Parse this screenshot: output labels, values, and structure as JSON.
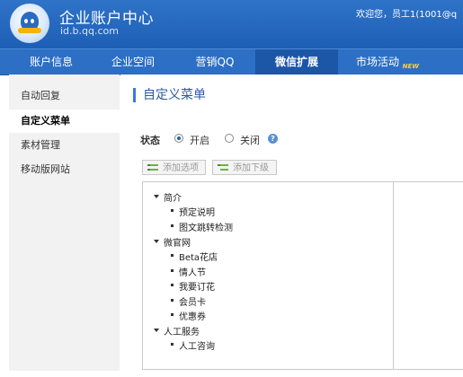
{
  "header": {
    "title": "企业账户中心",
    "subtitle": "id.b.qq.com",
    "welcome": "欢迎您，员工1(1001@q"
  },
  "nav": {
    "items": [
      {
        "label": "账户信息"
      },
      {
        "label": "企业空间"
      },
      {
        "label": "营销QQ"
      },
      {
        "label": "微信扩展"
      },
      {
        "label": "市场活动"
      }
    ],
    "new_badge": "NEW",
    "active": "微信扩展"
  },
  "sidebar": {
    "items": [
      {
        "label": "自动回复"
      },
      {
        "label": "自定义菜单"
      },
      {
        "label": "素材管理"
      },
      {
        "label": "移动版网站"
      }
    ],
    "active": "自定义菜单"
  },
  "main": {
    "title": "自定义菜单",
    "status_label": "状态",
    "status_on": "开启",
    "status_off": "关闭",
    "status_selected": "开启",
    "help": "?",
    "add_item_button": "添加选项",
    "add_sub_button": "添加下级"
  },
  "tree": {
    "groups": [
      {
        "label": "简介",
        "children": [
          "预定说明",
          "图文跳转检测"
        ]
      },
      {
        "label": "微官网",
        "children": [
          "Beta花店",
          "情人节",
          "我要订花",
          "会员卡",
          "优惠券"
        ]
      },
      {
        "label": "人工服务",
        "children": [
          "人工咨询"
        ]
      }
    ]
  }
}
